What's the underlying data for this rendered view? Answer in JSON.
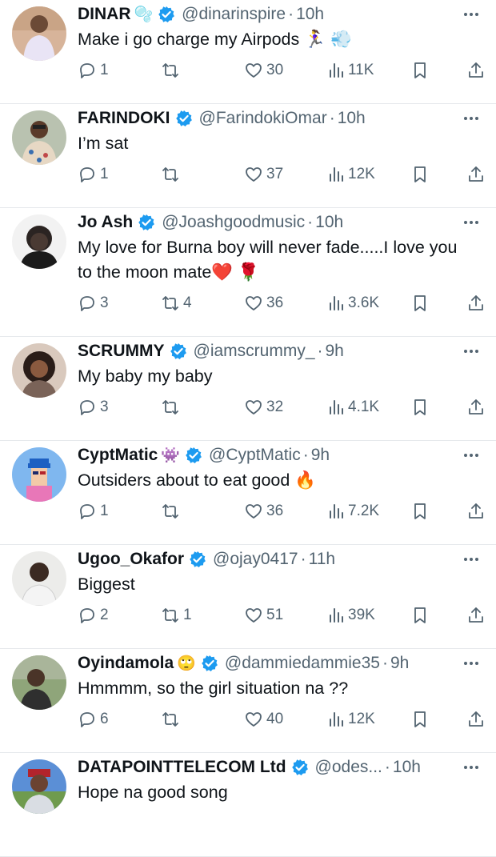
{
  "colors": {
    "verified": "#1d9bf0",
    "muted": "#536471",
    "text": "#0f1419",
    "divider": "#e6e9ec"
  },
  "tweets": [
    {
      "name": "DINAR",
      "name_emoji": "🫧",
      "handle": "@dinarinspire",
      "sep": "·",
      "time": "10h",
      "text": "Make i go charge my Airpods 🏃‍♀️ 💨",
      "replies": "1",
      "retweets": "",
      "likes": "30",
      "views": "11K",
      "icons": {
        "reply": "reply-icon",
        "retweet": "retweet-icon",
        "like": "heart-icon",
        "views": "views-icon",
        "bookmark": "bookmark-icon",
        "share": "share-icon"
      }
    },
    {
      "name": "FARINDOKI",
      "name_emoji": "",
      "handle": "@FarindokiOmar",
      "sep": "·",
      "time": "10h",
      "text": "I’m sat",
      "replies": "1",
      "retweets": "",
      "likes": "37",
      "views": "12K"
    },
    {
      "name": "Jo Ash",
      "name_emoji": "",
      "handle": "@Joashgoodmusic",
      "sep": "·",
      "time": "10h",
      "text": "My love for Burna boy will never fade.....I love you to the moon mate❤️ 🌹",
      "replies": "3",
      "retweets": "4",
      "likes": "36",
      "views": "3.6K"
    },
    {
      "name": "SCRUMMY",
      "name_emoji": "",
      "handle": "@iamscrummy_",
      "sep": "·",
      "time": "9h",
      "text": "My baby my baby",
      "replies": "3",
      "retweets": "",
      "likes": "32",
      "views": "4.1K"
    },
    {
      "name": "CyptMatic",
      "name_emoji": "👾",
      "handle": "@CyptMatic",
      "sep": "·",
      "time": "9h",
      "text": "Outsiders about to eat good 🔥",
      "replies": "1",
      "retweets": "",
      "likes": "36",
      "views": "7.2K"
    },
    {
      "name": "Ugoo_Okafor",
      "name_emoji": "",
      "handle": "@ojay0417",
      "sep": "·",
      "time": "11h",
      "text": "Biggest",
      "replies": "2",
      "retweets": "1",
      "likes": "51",
      "views": "39K"
    },
    {
      "name": "Oyindamola",
      "name_emoji": "🙄",
      "handle": "@dammiedammie35",
      "sep": "·",
      "time": "9h",
      "text": "Hmmmm, so the girl situation na ??",
      "replies": "6",
      "retweets": "",
      "likes": "40",
      "views": "12K"
    },
    {
      "name": "DATAPOINTTELECOM Ltd",
      "name_emoji": "",
      "handle": "@odes...",
      "sep": "·",
      "time": "10h",
      "text": "Hope na good song",
      "replies": "",
      "retweets": "",
      "likes": "",
      "views": ""
    }
  ],
  "icon_names": [
    "avatar",
    "verified-badge-icon",
    "more-options-icon",
    "reply-icon",
    "retweet-icon",
    "heart-icon",
    "views-icon",
    "bookmark-icon",
    "share-icon"
  ]
}
